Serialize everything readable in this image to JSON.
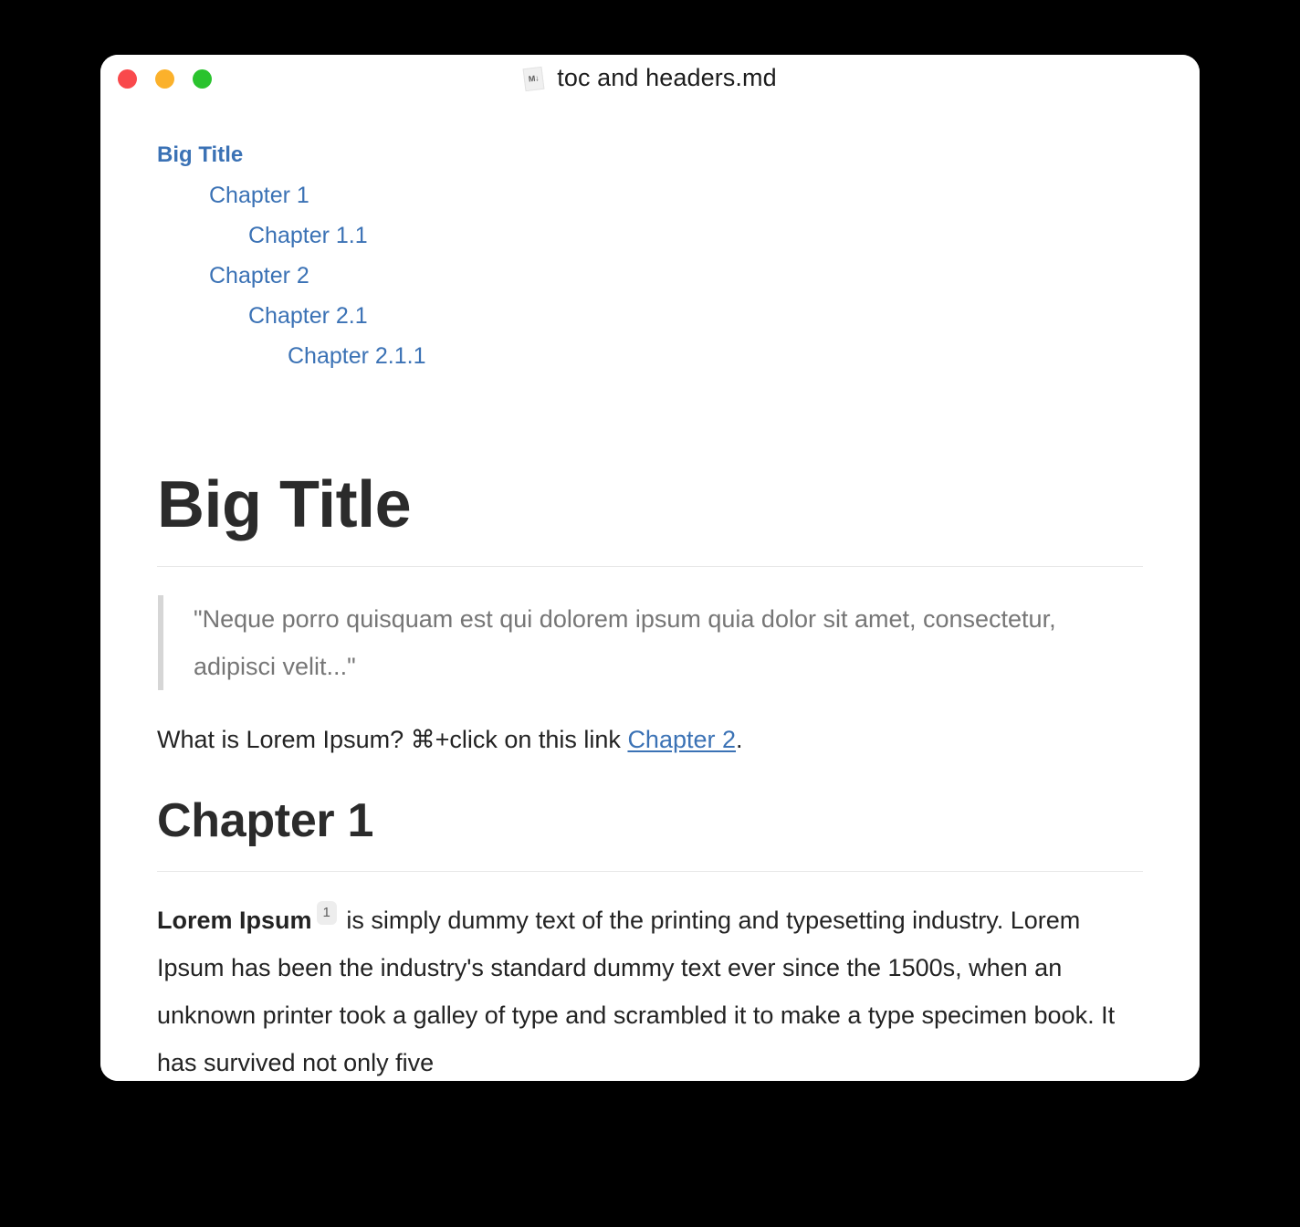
{
  "window": {
    "titlebar": {
      "title": "toc and headers.md",
      "doc_icon": "markdown-file-icon",
      "doc_icon_glyph": "M↓",
      "traffic_lights": [
        {
          "name": "close",
          "color": "#f9494c"
        },
        {
          "name": "minimize",
          "color": "#fbb12b"
        },
        {
          "name": "maximize",
          "color": "#2ac32e"
        }
      ]
    }
  },
  "toc": {
    "items": [
      {
        "label": "Big Title",
        "level": 1
      },
      {
        "label": "Chapter 1",
        "level": 2
      },
      {
        "label": "Chapter 1.1",
        "level": 3
      },
      {
        "label": "Chapter 2",
        "level": 2
      },
      {
        "label": "Chapter 2.1",
        "level": 3
      },
      {
        "label": "Chapter 2.1.1",
        "level": 4
      }
    ]
  },
  "document": {
    "h1": "Big Title",
    "blockquote": "\"Neque porro quisquam est qui dolorem ipsum quia dolor sit amet, consectetur, adipisci velit...\"",
    "intro_before_link": "What is Lorem Ipsum? ⌘+click on this link ",
    "intro_link": "Chapter 2",
    "intro_after_link": ".",
    "h2": "Chapter 1",
    "body_bold_lead": "Lorem Ipsum",
    "body_footnote": "1",
    "body_text": " is simply dummy text of the printing and typesetting industry. Lorem Ipsum has been the industry's standard dummy text ever since the 1500s, when an unknown printer took a galley of type and scrambled it to make a type specimen book. It has survived not only five"
  },
  "colors": {
    "link": "#3b72b5",
    "heading": "#2b2b2b",
    "body": "#232323",
    "quote": "#767676",
    "rule": "#e8e8e8",
    "quote_bar": "#d6d6d6",
    "footnote_bg": "#ededed"
  }
}
